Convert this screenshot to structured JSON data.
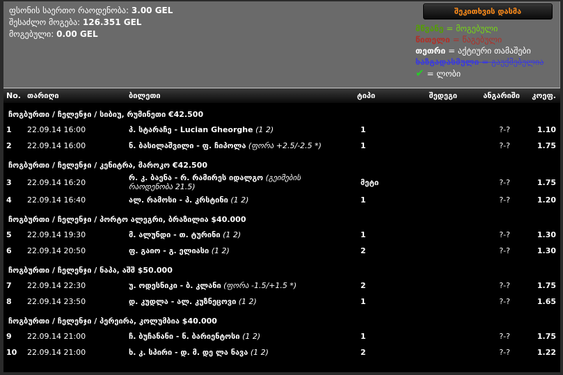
{
  "summary": {
    "lines": [
      {
        "label": "ფსონის საერთო რაოდენობა:",
        "value": "3.00 GEL"
      },
      {
        "label": "შესაძლო მოგება:",
        "value": "126.351 GEL"
      },
      {
        "label": "მოგებული:",
        "value": "0.00 GEL"
      }
    ]
  },
  "ask_button": {
    "label": "შეკითხვის დასმა"
  },
  "legend": {
    "check_glyph": "✔",
    "items": [
      {
        "term": "მწვანე",
        "sep": "=",
        "meaning": "მოგებული"
      },
      {
        "term": "წითელი",
        "sep": "=",
        "meaning": "წაგებული"
      },
      {
        "term": "თეთრი",
        "sep": "=",
        "meaning": "აქტიური თამაშები"
      },
      {
        "term": "ხაზგადასმული",
        "sep": "=",
        "meaning": "გაუქმებულია"
      },
      {
        "term": "",
        "sep": "=",
        "meaning": "ლობი"
      }
    ]
  },
  "colors": {
    "accent_orange": "#ff8c1a",
    "won_green": "#76d813",
    "lost_red": "#b03028",
    "cancelled_blue": "#3c3cd8",
    "top_panel_gray": "#6a6a6a"
  },
  "table": {
    "columns": [
      "No.",
      "თარიღი",
      "ბილეთი",
      "ტიპი",
      "შედეგი",
      "ანგარიში",
      "კოეფ."
    ],
    "sections": [
      {
        "title": "ჩოგბურთი / ჩელენჯი / სიბიუ, რუმინეთი €42.500",
        "rows": [
          {
            "no": "1",
            "date": "22.09.14 16:00",
            "match": "პ. სტარაჩე - Lucian Gheorghe",
            "bet": "(1 2)",
            "type": "1",
            "result": "",
            "score": "?-?",
            "coef": "1.10"
          },
          {
            "no": "2",
            "date": "22.09.14 16:00",
            "match": "ნ. ბასილაშვილი - ფ. ჩიპოლა",
            "bet": "(ფორა +2.5/-2.5 *)",
            "type": "1",
            "result": "",
            "score": "?-?",
            "coef": "1.75"
          }
        ]
      },
      {
        "title": "ჩოგბურთი / ჩელენჯი / კენიტრა, მაროკო €42.500",
        "rows": [
          {
            "no": "3",
            "date": "22.09.14 16:20",
            "match": "რ. კ. ბაენა - რ. რამირეს იდალგო",
            "bet": "(გეიმების რაოდენობა 21.5)",
            "type": "მეტი",
            "result": "",
            "score": "?-?",
            "coef": "1.75"
          },
          {
            "no": "4",
            "date": "22.09.14 16:40",
            "match": "ალ. რამოსი - პ. კრსტინი",
            "bet": "(1 2)",
            "type": "1",
            "result": "",
            "score": "?-?",
            "coef": "1.20"
          }
        ]
      },
      {
        "title": "ჩოგბურთი / ჩელენჯი / პორტო ალეგრი, ბრაზილია $40.000",
        "rows": [
          {
            "no": "5",
            "date": "22.09.14 19:30",
            "match": "მ. ალუნდი - თ. ტურინი",
            "bet": "(1 2)",
            "type": "1",
            "result": "",
            "score": "?-?",
            "coef": "1.30"
          },
          {
            "no": "6",
            "date": "22.09.14 20:50",
            "match": "ფ. გაიო - გ. ელიასი",
            "bet": "(1 2)",
            "type": "2",
            "result": "",
            "score": "?-?",
            "coef": "1.30"
          }
        ]
      },
      {
        "title": "ჩოგბურთი / ჩელენჯი / ნაპა, აშშ $50.000",
        "rows": [
          {
            "no": "7",
            "date": "22.09.14 22:30",
            "match": "უ. ოდესნიკი - ბ. კლანი",
            "bet": "(ფორა -1.5/+1.5 *)",
            "type": "2",
            "result": "",
            "score": "?-?",
            "coef": "1.75"
          },
          {
            "no": "8",
            "date": "22.09.14 23:50",
            "match": "დ. კუდლა - ალ. კუზნეცოვი",
            "bet": "(1 2)",
            "type": "1",
            "result": "",
            "score": "?-?",
            "coef": "1.65"
          }
        ]
      },
      {
        "title": "ჩოგბურთი / ჩელენჯი / პერეირა, კოლუმბია $40.000",
        "rows": [
          {
            "no": "9",
            "date": "22.09.14 21:00",
            "match": "ჩ. ბუჩანანი - ნ. ბარიენტოსი",
            "bet": "(1 2)",
            "type": "1",
            "result": "",
            "score": "?-?",
            "coef": "1.75"
          },
          {
            "no": "10",
            "date": "22.09.14 21:00",
            "match": "ხ. კ. სპირი - დ. მ. დე ლა ნავა",
            "bet": "(1 2)",
            "type": "2",
            "result": "",
            "score": "?-?",
            "coef": "1.22"
          }
        ]
      }
    ]
  }
}
